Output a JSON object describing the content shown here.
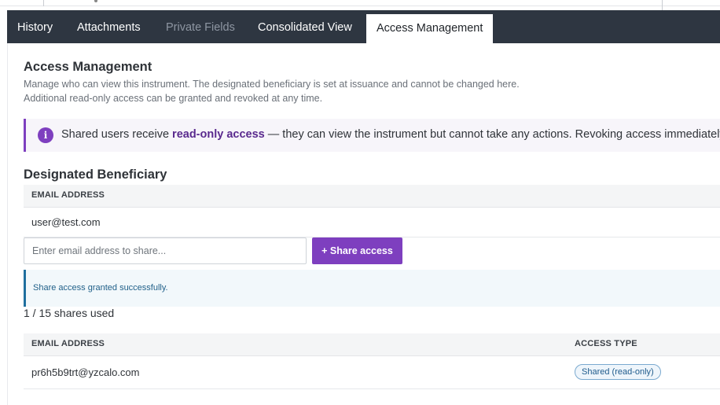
{
  "tabs": [
    {
      "label": "History",
      "state": "normal"
    },
    {
      "label": "Attachments",
      "state": "normal"
    },
    {
      "label": "Private Fields",
      "state": "disabled"
    },
    {
      "label": "Consolidated View",
      "state": "normal"
    },
    {
      "label": "Access Management",
      "state": "active"
    }
  ],
  "page": {
    "title": "Access Management",
    "description_line1": "Manage who can view this instrument. The designated beneficiary is set at issuance and cannot be changed here.",
    "description_line2": "Additional read-only access can be granted and revoked at any time."
  },
  "callout": {
    "icon": "info-icon",
    "text_before": "Shared users receive ",
    "text_emphasis": "read-only access",
    "text_after": " — they can view the instrument but cannot take any actions. Revoking access immediately"
  },
  "beneficiary": {
    "title": "Designated Beneficiary",
    "column_email": "EMAIL ADDRESS",
    "email": "user@test.com"
  },
  "share_form": {
    "placeholder": "Enter email address to share...",
    "value": "",
    "button_label": "+ Share access"
  },
  "alert": {
    "message": "Share access granted successfully."
  },
  "shares_used": "1 / 15 shares used",
  "shares_table": {
    "columns": [
      "EMAIL ADDRESS",
      "ACCESS TYPE"
    ],
    "rows": [
      {
        "email": "pr6h5b9trt@yzcalo.com",
        "access_type": "Shared (read-only)"
      }
    ]
  },
  "colors": {
    "tabbar": "#2e3641",
    "accent_purple": "#7e3fbf",
    "info_blue": "#1f6f9e"
  }
}
